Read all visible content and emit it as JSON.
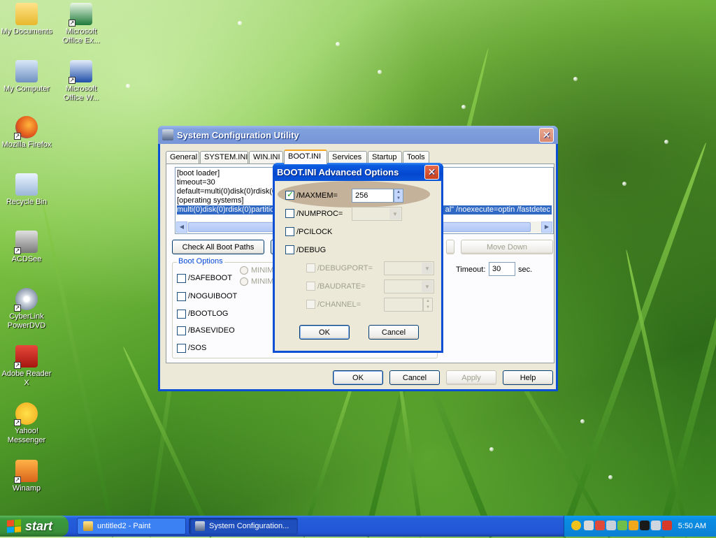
{
  "desktop": {
    "icons": [
      {
        "label": "My Documents"
      },
      {
        "label": "Microsoft Office Ex..."
      },
      {
        "label": "My Computer"
      },
      {
        "label": "Microsoft Office W..."
      },
      {
        "label": "Mozilla Firefox"
      },
      {
        "label": "Recycle Bin"
      },
      {
        "label": "ACDSee"
      },
      {
        "label": "CyberLink PowerDVD"
      },
      {
        "label": "Adobe Reader X"
      },
      {
        "label": "Yahoo! Messenger"
      },
      {
        "label": "Winamp"
      }
    ]
  },
  "syscfg": {
    "title": "System Configuration Utility",
    "tabs": [
      "General",
      "SYSTEM.INI",
      "WIN.INI",
      "BOOT.INI",
      "Services",
      "Startup",
      "Tools"
    ],
    "active_tab": "BOOT.INI",
    "lines": [
      "[boot loader]",
      "timeout=30",
      "default=multi(0)disk(0)rdisk(0",
      "[operating systems]",
      "multi(0)disk(0)rdisk(0)partition"
    ],
    "selected_line_tail": "al\" /noexecute=optin /fastdetec",
    "check_all_label": "Check All Boot Paths",
    "move_down_label": "Move Down",
    "boot_options_label": "Boot Options",
    "options": [
      "/SAFEBOOT",
      "/NOGUIBOOT",
      "/BOOTLOG",
      "/BASEVIDEO",
      "/SOS"
    ],
    "radio_labels": [
      "MINIMA",
      "MINIMA"
    ],
    "timeout_label": "Timeout:",
    "timeout_value": "30",
    "timeout_unit": "sec.",
    "ok": "OK",
    "cancel": "Cancel",
    "apply": "Apply",
    "help": "Help"
  },
  "advanced": {
    "title": "BOOT.INI Advanced Options",
    "maxmem": {
      "label": "/MAXMEM=",
      "checked": true,
      "value": "256"
    },
    "numproc": {
      "label": "/NUMPROC="
    },
    "pcilock": {
      "label": "/PCILOCK"
    },
    "debug": {
      "label": "/DEBUG"
    },
    "debugport": {
      "label": "/DEBUGPORT="
    },
    "baudrate": {
      "label": "/BAUDRATE="
    },
    "channel": {
      "label": "/CHANNEL="
    },
    "ok": "OK",
    "cancel": "Cancel"
  },
  "taskbar": {
    "start": "start",
    "tasks": [
      {
        "label": "untitled2 - Paint"
      },
      {
        "label": "System Configuration..."
      }
    ],
    "clock": "5:50 AM"
  },
  "colors": {
    "xp_blue": "#0a4fd4",
    "start_green": "#3c9a3c",
    "tray_blue": "#0b7fd4",
    "selection": "#316ac5"
  }
}
